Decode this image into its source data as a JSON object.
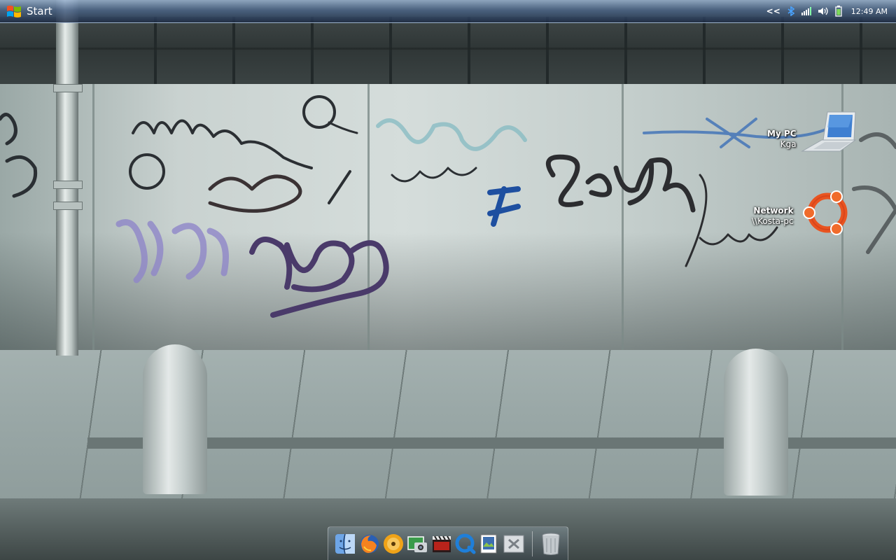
{
  "taskbar": {
    "start_label": "Start",
    "tray": {
      "collapse": "<<",
      "clock": "12:49 AM"
    }
  },
  "desktop_icons": [
    {
      "title": "My PC",
      "subtitle": "Kga",
      "icon": "laptop-icon"
    },
    {
      "title": "Network",
      "subtitle": "\\\\Kosta-pc",
      "icon": "ubuntu-network-icon"
    }
  ],
  "dock": {
    "items": [
      "finder-icon",
      "firefox-icon",
      "dvd-player-icon",
      "iphoto-icon",
      "movie-clapper-icon",
      "quicktime-icon",
      "preview-icon",
      "utilities-icon"
    ],
    "trash": "trash-icon"
  },
  "colors": {
    "taskbar_top": "#96afcd",
    "taskbar_bottom": "#1e2d46",
    "ubuntu_orange": "#e95420"
  }
}
